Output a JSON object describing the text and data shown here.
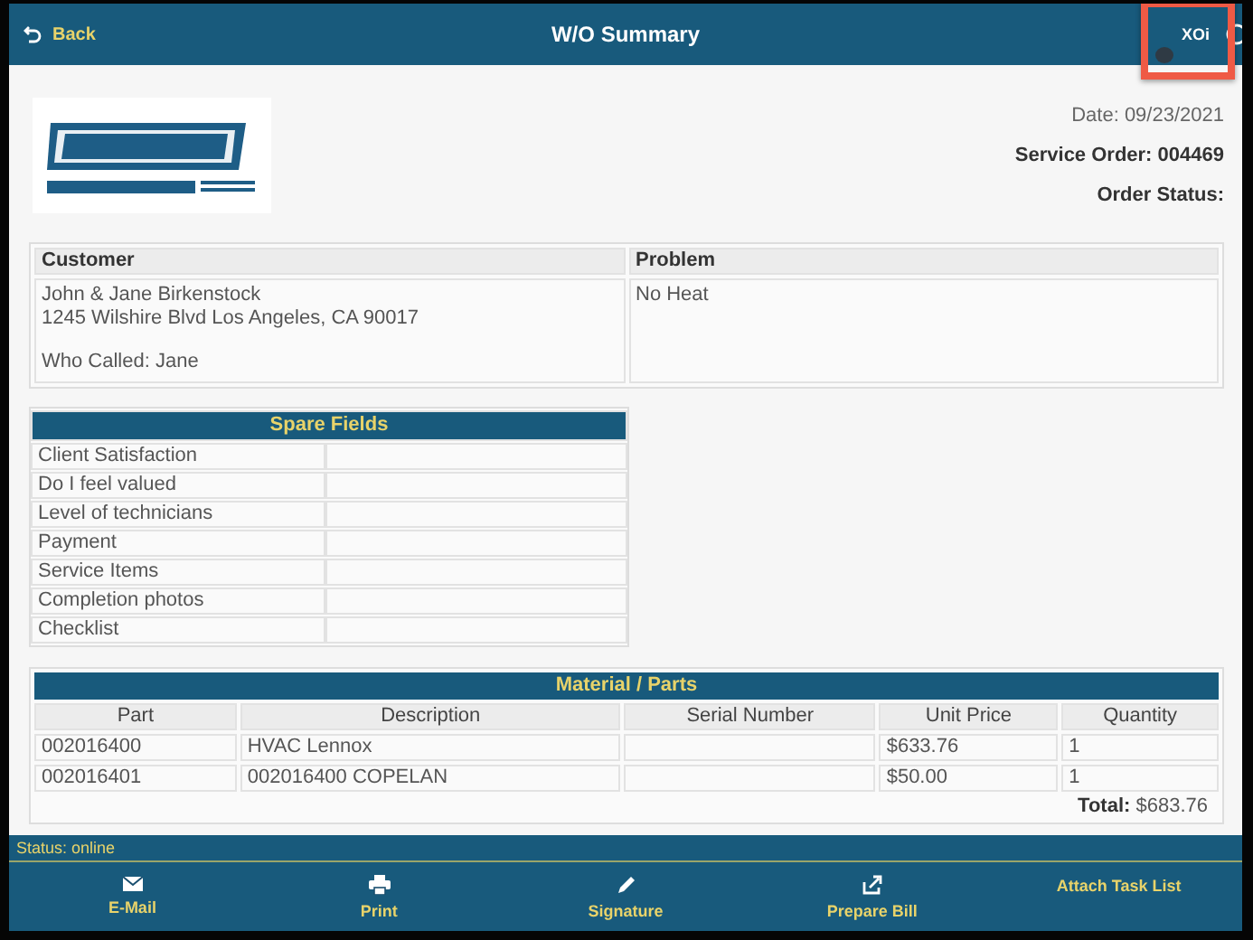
{
  "header": {
    "back": "Back",
    "title": "W/O Summary",
    "xoi": "XOi"
  },
  "order": {
    "date": "Date: 09/23/2021",
    "service_order": "Service Order: 004469",
    "order_status": "Order Status:"
  },
  "customer_table": {
    "columns": [
      "Customer",
      "Problem"
    ],
    "customer": {
      "name": "John & Jane Birkenstock",
      "address": "1245 Wilshire Blvd Los Angeles, CA 90017",
      "who_called": "Who Called: Jane"
    },
    "problem": "No Heat"
  },
  "spare_fields": {
    "title": "Spare Fields",
    "rows": [
      "Client Satisfaction",
      "Do I feel valued",
      "Level of technicians",
      "Payment",
      "Service Items",
      "Completion photos",
      "Checklist"
    ]
  },
  "parts": {
    "title": "Material / Parts",
    "columns": [
      "Part",
      "Description",
      "Serial Number",
      "Unit Price",
      "Quantity"
    ],
    "rows": [
      [
        "002016400",
        "HVAC Lennox",
        "",
        "$633.76",
        "1"
      ],
      [
        "002016401",
        "002016400 COPELAN",
        "",
        "$50.00",
        "1"
      ]
    ],
    "total_label": "Total:",
    "total": "$683.76"
  },
  "status_bar": "Status: online",
  "toolbar": [
    {
      "kind": "mail",
      "label": "E-Mail"
    },
    {
      "kind": "print",
      "label": "Print"
    },
    {
      "kind": "pen",
      "label": "Signature"
    },
    {
      "kind": "share",
      "label": "Prepare Bill"
    },
    {
      "kind": "none",
      "label": "Attach Task List"
    }
  ]
}
